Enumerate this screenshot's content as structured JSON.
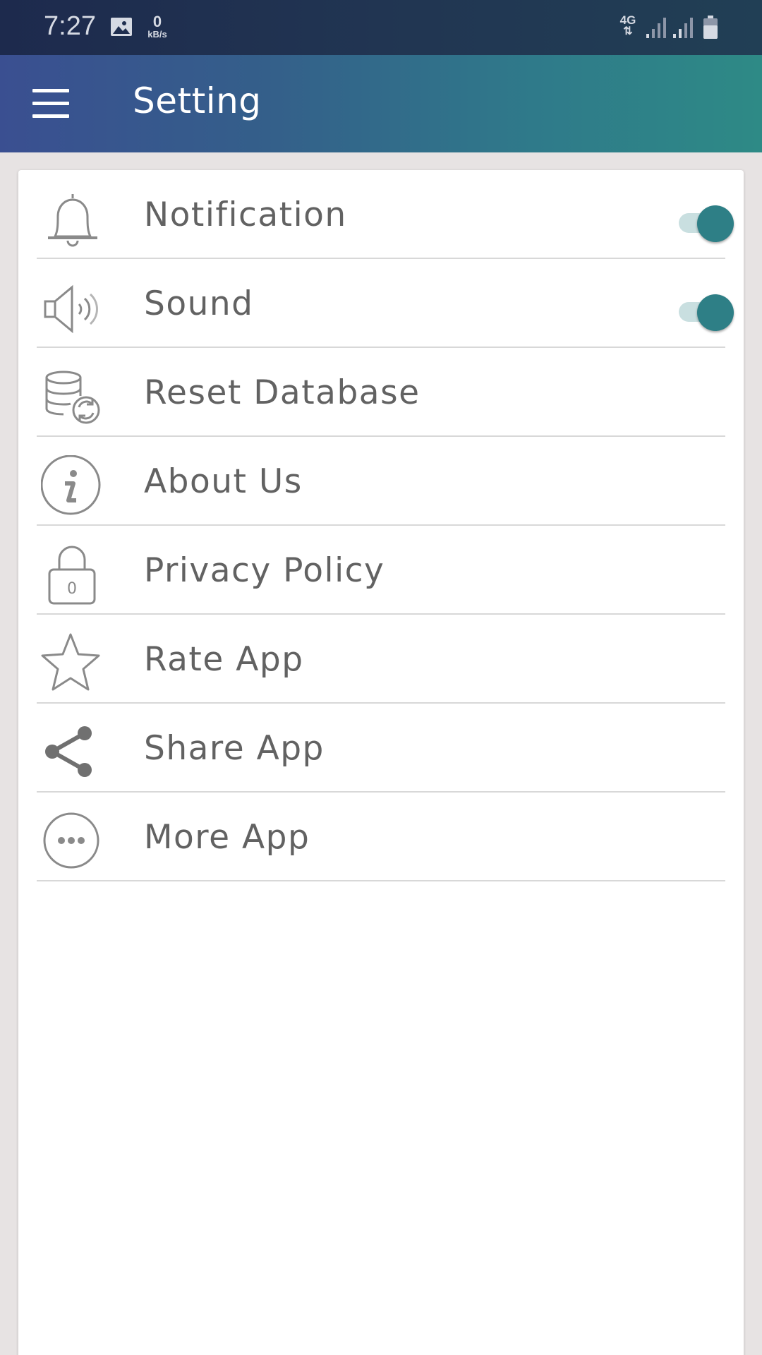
{
  "status_bar": {
    "time": "7:27",
    "data_speed_value": "0",
    "data_speed_unit": "kB/s",
    "network_type": "4G",
    "network_arrows": "⇅"
  },
  "app_bar": {
    "title": "Setting"
  },
  "settings": {
    "items": [
      {
        "label": "Notification",
        "icon": "bell-icon",
        "toggle": true,
        "enabled": true
      },
      {
        "label": "Sound",
        "icon": "speaker-icon",
        "toggle": true,
        "enabled": true
      },
      {
        "label": "Reset Database",
        "icon": "database-refresh-icon",
        "toggle": false
      },
      {
        "label": "About Us",
        "icon": "info-icon",
        "toggle": false
      },
      {
        "label": "Privacy Policy",
        "icon": "lock-icon",
        "toggle": false
      },
      {
        "label": "Rate App",
        "icon": "star-icon",
        "toggle": false
      },
      {
        "label": "Share App",
        "icon": "share-icon",
        "toggle": false
      },
      {
        "label": "More App",
        "icon": "more-dots-icon",
        "toggle": false
      }
    ],
    "lock_icon_digit": "0"
  },
  "colors": {
    "accent": "#2e7f86",
    "toggle_track": "#c9dfe0",
    "label_text": "#626262",
    "icon_stroke": "#8a8a8a",
    "app_bar_start": "#3a4f91",
    "app_bar_end": "#2e8a86"
  }
}
